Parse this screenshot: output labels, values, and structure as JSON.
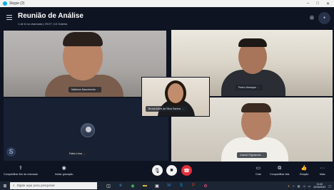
{
  "os_window": {
    "title": "Skype (2)",
    "controls": [
      "–",
      "□",
      "✕"
    ]
  },
  "call": {
    "title": "Reunião de Análise",
    "subtitle": "1 de 6 na chamada | 29:07 | 10 Galeria",
    "view_icon": "gallery-icon",
    "add_people_icon": "add-person-icon"
  },
  "participants": [
    {
      "name": "Matheus Nascimento"
    },
    {
      "name": "Pedro Henrique"
    },
    {
      "name": "Bruna Alves da Silva Santos"
    },
    {
      "name": "Fabio Lima"
    },
    {
      "name": "Gabriel Figueiredo"
    }
  ],
  "controls": {
    "share_link": "Compartilhar link da chamada",
    "start_recording": "Iniciar gravação",
    "chat": "Chat",
    "share_screen": "Compartilhar tela",
    "react": "Reação",
    "more": "Mais"
  },
  "taskbar": {
    "search_placeholder": "Digite aqui para pesquisar",
    "time": "13:45",
    "date": "30/06/2020"
  },
  "colors": {
    "end_call": "#e3303a",
    "background": "#0f1422",
    "skype_blue": "#00aff0"
  }
}
